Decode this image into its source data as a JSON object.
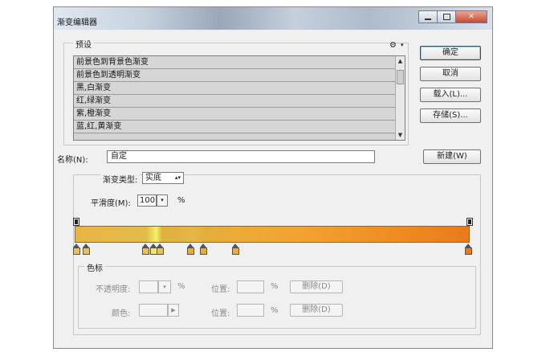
{
  "window": {
    "title": "渐变编辑器"
  },
  "presets": {
    "group_label": "预设",
    "items": [
      "前景色到背景色渐变",
      "前景色到透明渐变",
      "黑,白渐变",
      "红,绿渐变",
      "紫,橙渐变",
      "蓝,红,黄渐变"
    ]
  },
  "buttons": {
    "ok": "确定",
    "cancel": "取消",
    "load": "载入(L)...",
    "save": "存储(S)...",
    "new": "新建(W)"
  },
  "name": {
    "label": "名称(N):",
    "value": "自定"
  },
  "gradient": {
    "type_label": "渐变类型:",
    "type_value": "实底",
    "smoothness_label": "平滑度(M):",
    "smoothness_value": "100",
    "smoothness_unit": "%",
    "bar_colors": [
      "#e8b545",
      "#f4ef6a",
      "#ecac37",
      "#ea7a1c"
    ]
  },
  "stops": {
    "group_label": "色标",
    "opacity_label": "不透明度:",
    "opacity_unit": "%",
    "location_label": "位置:",
    "location_unit": "%",
    "color_label": "颜色:",
    "delete_label": "删除(D)"
  }
}
